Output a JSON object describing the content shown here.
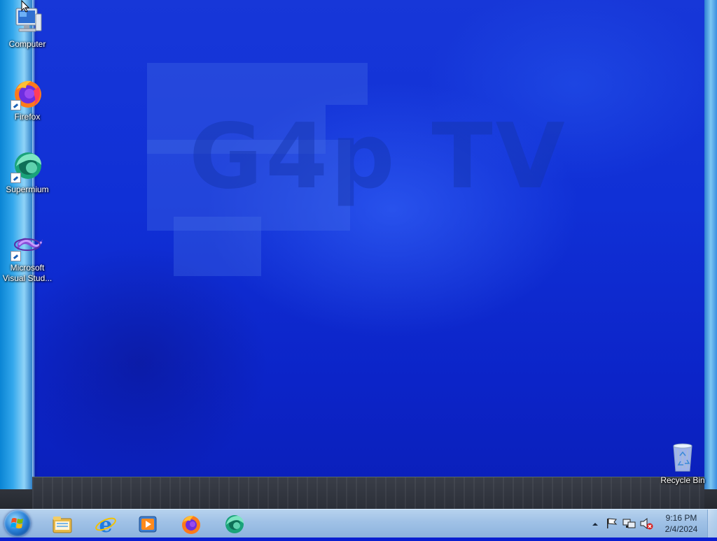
{
  "desktop": {
    "icons": [
      {
        "label": "Computer",
        "icon": "computer-icon"
      },
      {
        "label": "Firefox",
        "icon": "firefox-icon"
      },
      {
        "label": "Supermium",
        "icon": "supermium-icon"
      },
      {
        "label_line1": "Microsoft",
        "label_line2": "Visual Stud...",
        "icon": "visual-studio-icon"
      }
    ],
    "recycle_bin": {
      "label": "Recycle Bin",
      "icon": "recycle-bin-icon"
    },
    "wallpaper_watermark": "G4p TV"
  },
  "taskbar": {
    "start": "start-button",
    "pinned": [
      {
        "icon": "file-explorer-icon"
      },
      {
        "icon": "internet-explorer-icon"
      },
      {
        "icon": "media-player-icon"
      },
      {
        "icon": "firefox-icon"
      },
      {
        "icon": "supermium-icon"
      }
    ],
    "tray": {
      "icons": [
        "show-hidden-icons",
        "action-center-flag-icon",
        "network-icon",
        "volume-muted-icon"
      ],
      "time": "9:16 PM",
      "date": "2/4/2024"
    }
  },
  "colors": {
    "wallpaper": "#1030d6",
    "taskbar": "#9fc1e6",
    "frame_blue": "#33a8ec"
  }
}
